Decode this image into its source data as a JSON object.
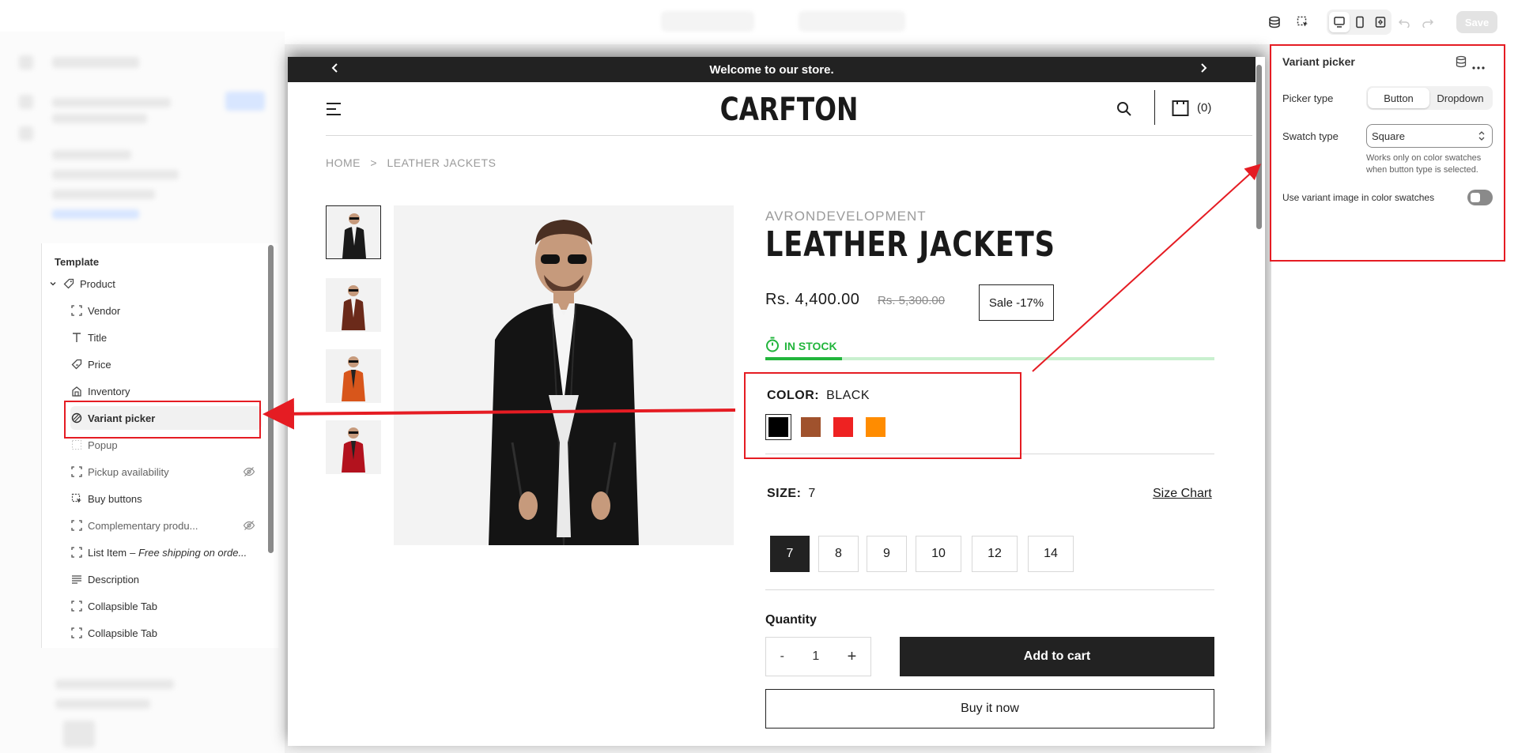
{
  "toolbar": {
    "save_label": "Save"
  },
  "template_panel": {
    "title": "Template",
    "items": [
      {
        "label": "Product",
        "icon": "tag-icon"
      },
      {
        "label": "Vendor",
        "icon": "block-icon"
      },
      {
        "label": "Title",
        "icon": "text-icon"
      },
      {
        "label": "Price",
        "icon": "price-tag-icon"
      },
      {
        "label": "Inventory",
        "icon": "inventory-icon"
      },
      {
        "label": "Variant picker",
        "icon": "variant-icon"
      },
      {
        "label": "Popup",
        "icon": "dotted-block-icon"
      },
      {
        "label": "Pickup availability",
        "icon": "block-icon"
      },
      {
        "label": "Buy buttons",
        "icon": "cursor-icon"
      },
      {
        "label": "Complementary produ...",
        "icon": "block-icon"
      },
      {
        "label": "List Item",
        "label_suffix": "– Free shipping on orde...",
        "icon": "block-icon"
      },
      {
        "label": "Description",
        "icon": "paragraph-icon"
      },
      {
        "label": "Collapsible Tab",
        "icon": "block-icon"
      },
      {
        "label": "Collapsible Tab",
        "icon": "block-icon"
      }
    ]
  },
  "store": {
    "announcement": "Welcome to our store.",
    "logo": "CARFTON",
    "cart_count": "(0)",
    "breadcrumb": {
      "home": "HOME",
      "sep": ">",
      "current": "LEATHER JACKETS"
    },
    "vendor": "AVRONDEVELOPMENT",
    "title": "LEATHER JACKETS",
    "price": "Rs. 4,400.00",
    "compare_price": "Rs. 5,300.00",
    "sale_badge": "Sale -17%",
    "stock_label": "IN STOCK",
    "stock_level": 0.17,
    "color_label": "COLOR:",
    "color_value": "BLACK",
    "swatches": [
      {
        "name": "Black",
        "color": "#000000"
      },
      {
        "name": "Brown",
        "color": "#a0522d"
      },
      {
        "name": "Red",
        "color": "#ee2222"
      },
      {
        "name": "Orange",
        "color": "#ff8c00"
      }
    ],
    "size_label": "SIZE:",
    "size_value": "7",
    "size_chart": "Size Chart",
    "sizes": [
      "7",
      "8",
      "9",
      "10",
      "12",
      "14"
    ],
    "quantity_label": "Quantity",
    "qty_minus": "-",
    "qty_value": "1",
    "qty_plus": "+",
    "add_to_cart": "Add to cart",
    "buy_now": "Buy it now"
  },
  "settings_panel": {
    "title": "Variant picker",
    "picker_type_label": "Picker type",
    "picker_options": [
      "Button",
      "Dropdown"
    ],
    "swatch_type_label": "Swatch type",
    "swatch_value": "Square",
    "swatch_help": "Works only on color swatches when button type is selected.",
    "variant_image_label": "Use variant image in color swatches"
  },
  "colors": {
    "annotation": "#e51c23",
    "stock_green": "#22b53c",
    "dark": "#222222"
  }
}
